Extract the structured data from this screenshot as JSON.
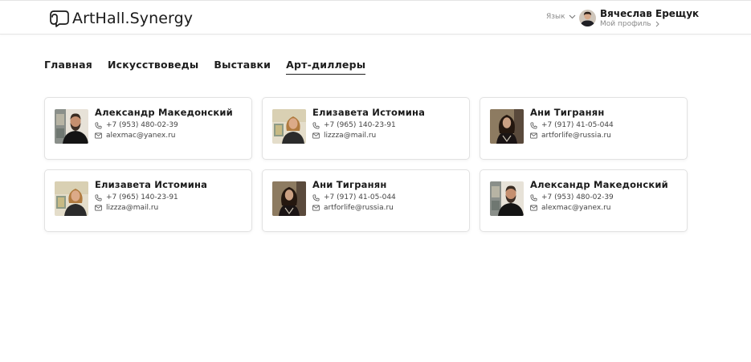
{
  "header": {
    "logo_text": "ArtHall.Synergy",
    "language_label": "Язык",
    "user": {
      "name": "Вячеслав Ерещук",
      "profile_link": "Мой профиль"
    }
  },
  "nav": {
    "tabs": [
      {
        "label": "Главная",
        "active": false
      },
      {
        "label": "Искусствоведы",
        "active": false
      },
      {
        "label": "Выставки",
        "active": false
      },
      {
        "label": "Арт-диллеры",
        "active": true
      }
    ]
  },
  "dealers": [
    {
      "name": "Александр Македонский",
      "phone": "+7 (953) 480-02-39",
      "email": "alexmac@yanex.ru",
      "photo": "man-beard-photo"
    },
    {
      "name": "Елизавета Истомина",
      "phone": "+7 (965) 140-23-91",
      "email": "lizzza@mail.ru",
      "photo": "woman-blonde-photo"
    },
    {
      "name": "Ани Тигранян",
      "phone": "+7 (917) 41-05-044",
      "email": "artforlife@russia.ru",
      "photo": "woman-dark-photo"
    },
    {
      "name": "Елизавета Истомина",
      "phone": "+7 (965) 140-23-91",
      "email": "lizzza@mail.ru",
      "photo": "woman-blonde-photo"
    },
    {
      "name": "Ани Тигранян",
      "phone": "+7 (917) 41-05-044",
      "email": "artforlife@russia.ru",
      "photo": "woman-dark-photo"
    },
    {
      "name": "Александр Македонский",
      "phone": "+7 (953) 480-02-39",
      "email": "alexmac@yanex.ru",
      "photo": "man-beard-photo"
    }
  ],
  "colors": {
    "text": "#1a1a1a",
    "muted": "#8a8a8a",
    "border": "#e2e2e2",
    "background": "#ffffff"
  }
}
